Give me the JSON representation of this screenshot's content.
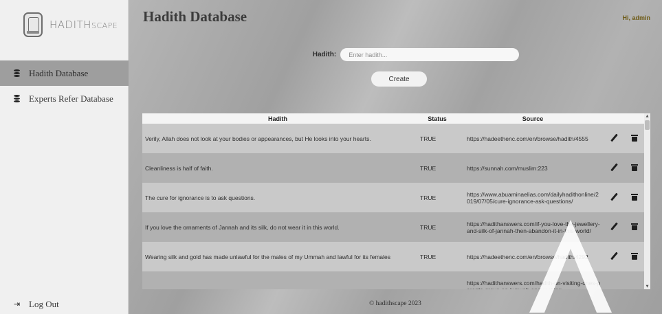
{
  "brand": {
    "name_large": "HADITH",
    "name_small": "SCAPE"
  },
  "sidebar": {
    "items": [
      {
        "label": "Hadith Database",
        "icon": "database-icon",
        "active": true
      },
      {
        "label": "Experts Refer Database",
        "icon": "database-icon",
        "active": false
      }
    ],
    "logout": {
      "label": "Log Out",
      "icon": "sign-out-icon"
    }
  },
  "header": {
    "title": "Hadith Database",
    "greeting": "Hi, admin"
  },
  "form": {
    "label": "Hadith:",
    "placeholder": "Enter hadith...",
    "value": "",
    "create_label": "Create"
  },
  "table": {
    "columns": [
      "Hadith",
      "Status",
      "Source"
    ],
    "rows": [
      {
        "hadith": "Verily, Allah does not look at your bodies or appearances, but He looks into your hearts.",
        "status": "TRUE",
        "source": "https://hadeethenc.com/en/browse/hadith/4555"
      },
      {
        "hadith": "Cleanliness is half of faith.",
        "status": "TRUE",
        "source": "https://sunnah.com/muslim:223"
      },
      {
        "hadith": "The cure for ignorance is to ask questions.",
        "status": "TRUE",
        "source": "https://www.abuaminaelias.com/dailyhadithonline/2019/07/05/cure-ignorance-ask-questions/"
      },
      {
        "hadith": "If you love the ornaments of Jannah and its silk, do not wear it in this world.",
        "status": "TRUE",
        "source": "https://hadithanswers.com/if-you-love-the-jewellery-and-silk-of-jannah-then-abandon-it-in-this-world/"
      },
      {
        "hadith": "Wearing silk and gold has made unlawful for the males of my Ummah and lawful for its females",
        "status": "TRUE",
        "source": "https://hadeethenc.com/en/browse/hadith/4292"
      },
      {
        "hadith": "",
        "status": "",
        "source": "https://hadithanswers.com/hadith-on-visiting-ones-parents-grave-on-jumuah-and-reciting-"
      }
    ],
    "row_actions": [
      "pencil-icon",
      "trash-icon"
    ]
  },
  "footer": {
    "text": "© hadithscape 2023"
  },
  "colors": {
    "greeting": "#6e5b17",
    "active_nav": "#9e9e9e",
    "row_light": "#c9c9c9",
    "row_dark": "#b1b1b1"
  }
}
